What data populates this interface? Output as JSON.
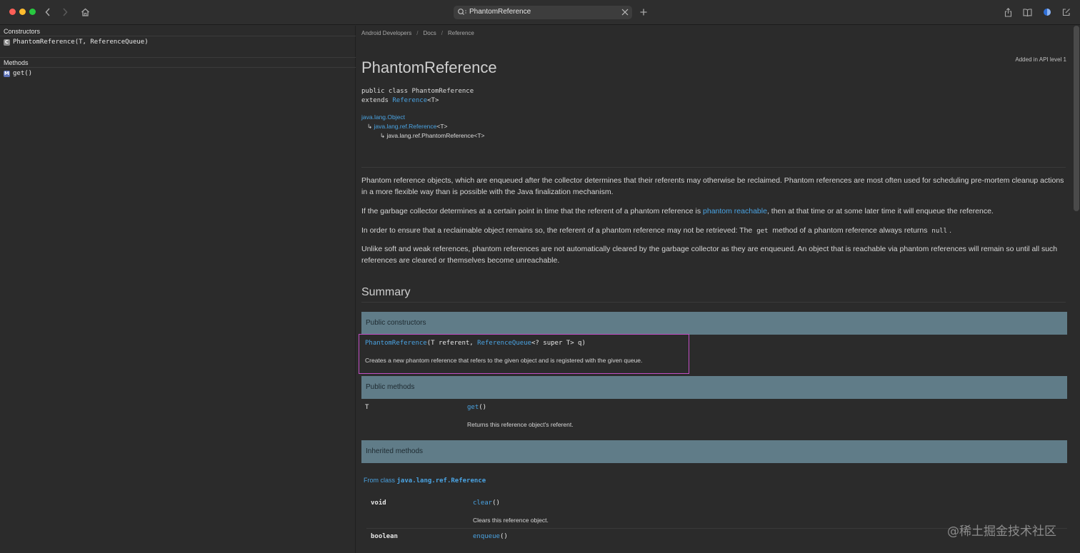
{
  "browser": {
    "address": "PhantomReference"
  },
  "sidebar": {
    "constructors_heading": "Constructors",
    "constructors": [
      {
        "badge": "C",
        "label": "PhantomReference(T, ReferenceQueue)"
      }
    ],
    "methods_heading": "Methods",
    "methods": [
      {
        "badge": "M",
        "label": "get()"
      }
    ]
  },
  "breadcrumb": {
    "items": [
      "Android Developers",
      "Docs",
      "Reference"
    ],
    "separator": "/"
  },
  "api_level": "Added in API level 1",
  "page_title": "PhantomReference",
  "declaration": {
    "line1": "public class PhantomReference",
    "extends_kw": "extends",
    "extends_link": "Reference",
    "extends_generic": "<T>"
  },
  "hierarchy": {
    "root": "java.lang.Object",
    "arrow": "↳",
    "mid_link": "java.lang.ref.Reference",
    "mid_generic": "<T>",
    "leaf": "java.lang.ref.PhantomReference<T>"
  },
  "description": {
    "p1": "Phantom reference objects, which are enqueued after the collector determines that their referents may otherwise be reclaimed. Phantom references are most often used for scheduling pre-mortem cleanup actions in a more flexible way than is possible with the Java finalization mechanism.",
    "p2_before": "If the garbage collector determines at a certain point in time that the referent of a phantom reference is ",
    "p2_link": "phantom reachable",
    "p2_after": ", then at that time or at some later time it will enqueue the reference.",
    "p3_before": "In order to ensure that a reclaimable object remains so, the referent of a phantom reference may not be retrieved: The ",
    "p3_code1": "get",
    "p3_middle": " method of a phantom reference always returns ",
    "p3_code2": "null",
    "p3_after": ".",
    "p4": "Unlike soft and weak references, phantom references are not automatically cleared by the garbage collector as they are enqueued. An object that is reachable via phantom references will remain so until all such references are cleared or themselves become unreachable."
  },
  "summary": {
    "heading": "Summary",
    "public_constructors": "Public constructors",
    "ctor": {
      "name": "PhantomReference",
      "open": "(T referent, ",
      "param_link": "ReferenceQueue",
      "close": "<? super T> q)",
      "desc": "Creates a new phantom reference that refers to the given object and is registered with the given queue."
    },
    "public_methods": "Public methods",
    "method": {
      "type": "T",
      "name": "get",
      "parens": "()",
      "desc": "Returns this reference object's referent."
    },
    "inherited_methods": "Inherited methods",
    "from_label": "From class ",
    "from_class": "java.lang.ref.Reference",
    "inherited": [
      {
        "type": "void",
        "name": "clear",
        "parens": "()",
        "desc": "Clears this reference object."
      },
      {
        "type": "boolean",
        "name": "enqueue",
        "parens": "()"
      }
    ]
  },
  "watermark": "@稀土掘金技术社区",
  "colors": {
    "link": "#4aa3e2",
    "band": "#607c88",
    "highlight_box": "#c24fc4"
  }
}
